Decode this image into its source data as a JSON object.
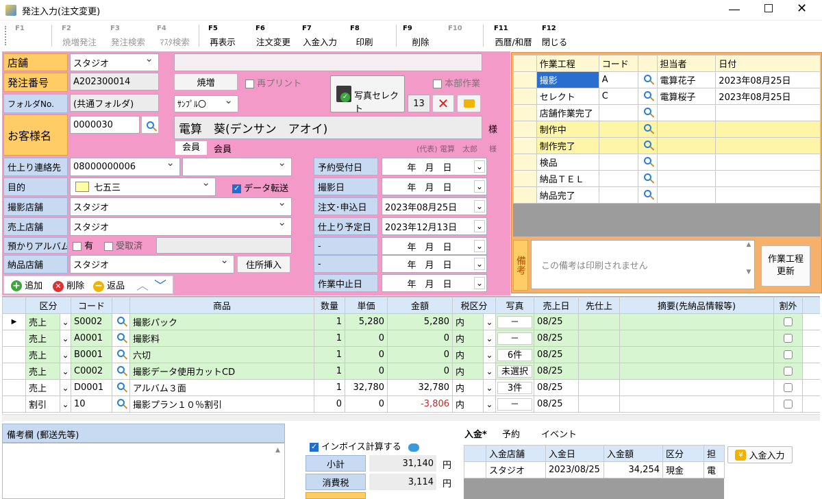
{
  "window": {
    "title": "発注入力(注文変更)"
  },
  "fkeys": [
    {
      "key": "F1",
      "label": "",
      "enabled": false
    },
    {
      "key": "F2",
      "label": "焼増発注",
      "enabled": false
    },
    {
      "key": "F3",
      "label": "発注検索",
      "enabled": false
    },
    {
      "key": "F4",
      "label": "ﾏｽﾀ検索",
      "enabled": false
    },
    {
      "key": "F5",
      "label": "再表示",
      "enabled": true
    },
    {
      "key": "F6",
      "label": "注文変更",
      "enabled": true
    },
    {
      "key": "F7",
      "label": "入金入力",
      "enabled": true
    },
    {
      "key": "F8",
      "label": "印刷",
      "enabled": true
    },
    {
      "key": "F9",
      "label": "削除",
      "enabled": true
    },
    {
      "key": "F10",
      "label": "",
      "enabled": false
    },
    {
      "key": "F11",
      "label": "西暦/和暦",
      "enabled": true
    },
    {
      "key": "F12",
      "label": "閉じる",
      "enabled": true
    }
  ],
  "header": {
    "store_label": "店舗",
    "store_value": "スタジオ",
    "order_no_label": "発注番号",
    "order_no_value": "A202300014",
    "folder_label": "フォルダNo.",
    "folder_value": "(共通フォルダ)",
    "customer_label": "お客様名",
    "customer_code": "0000030",
    "customer_name": "電算　葵(デンサン　アオイ)",
    "honorific": "様",
    "member_badge": "会員",
    "member_text": "会員",
    "rep_text": "(代表) 電算　太郎",
    "rep_honorific": "様",
    "yakimashi_btn": "焼増",
    "reprint_label": "再プリント",
    "sample_value": "ｻﾝﾌﾟﾙ〇",
    "photo_select_btn": "写真セレクト",
    "honbu_label": "本部作業",
    "photo_count": "13"
  },
  "form": {
    "contact_label": "仕上り連絡先",
    "contact_value": "08000000006",
    "contact_value2": "",
    "purpose_label": "目的",
    "purpose_value": "七五三",
    "purpose_color": "#ffffa8",
    "data_transfer_label": "データ転送",
    "shoot_store_label": "撮影店舗",
    "shoot_store_value": "スタジオ",
    "sales_store_label": "売上店舗",
    "sales_store_value": "スタジオ",
    "album_label": "預かりアルバム",
    "album_has": "有",
    "album_received": "受取済",
    "album_note": "",
    "delivery_store_label": "納品店舗",
    "delivery_store_value": "スタジオ",
    "address_btn": "住所挿入"
  },
  "dates": [
    {
      "label": "予約受付日",
      "value": "年　月　日"
    },
    {
      "label": "撮影日",
      "value": "年　月　日"
    },
    {
      "label": "注文･申込日",
      "value": "2023年08月25日"
    },
    {
      "label": "仕上り予定日",
      "value": "2023年12月13日"
    },
    {
      "label": "-",
      "value": "年　月　日"
    },
    {
      "label": "-",
      "value": "年　月　日"
    },
    {
      "label": "作業中止日",
      "value": "年　月　日"
    }
  ],
  "row_actions": {
    "add": "追加",
    "delete": "削除",
    "return": "返品"
  },
  "workflow": {
    "headers": [
      "作業工程",
      "コード",
      "担当者",
      "日付"
    ],
    "rows": [
      {
        "step": "撮影",
        "code": "A",
        "person": "電算花子",
        "date": "2023年08月25日"
      },
      {
        "step": "セレクト",
        "code": "C",
        "person": "電算桜子",
        "date": "2023年08月25日"
      },
      {
        "step": "店舗作業完了",
        "code": "",
        "person": "",
        "date": ""
      },
      {
        "step": "制作中",
        "code": "",
        "person": "",
        "date": ""
      },
      {
        "step": "制作完了",
        "code": "",
        "person": "",
        "date": ""
      },
      {
        "step": "検品",
        "code": "",
        "person": "",
        "date": ""
      },
      {
        "step": "納品ＴＥＬ",
        "code": "",
        "person": "",
        "date": ""
      },
      {
        "step": "納品完了",
        "code": "",
        "person": "",
        "date": ""
      }
    ],
    "memo_label": "備考",
    "memo_placeholder": "この備考は印刷されません",
    "update_btn": "作業工程\n更新"
  },
  "grid": {
    "headers": [
      "区分",
      "コード",
      "商品",
      "数量",
      "単価",
      "金額",
      "税区分",
      "写真",
      "売上日",
      "先仕上",
      "摘要(先納品情報等)",
      "割外"
    ],
    "rows": [
      {
        "kubun": "売上",
        "code": "S0002",
        "item": "撮影パック",
        "qty": "1",
        "price": "5,280",
        "amount": "5,280",
        "tax": "内",
        "photo": "－",
        "date": "08/25",
        "green": true,
        "neg": false
      },
      {
        "kubun": "売上",
        "code": "A0001",
        "item": "撮影料",
        "qty": "1",
        "price": "0",
        "amount": "0",
        "tax": "内",
        "photo": "－",
        "date": "08/25",
        "green": true,
        "neg": false
      },
      {
        "kubun": "売上",
        "code": "B0001",
        "item": "六切",
        "qty": "1",
        "price": "0",
        "amount": "0",
        "tax": "内",
        "photo": "6件",
        "date": "08/25",
        "green": true,
        "neg": false
      },
      {
        "kubun": "売上",
        "code": "C0002",
        "item": "撮影データ使用カットCD",
        "qty": "1",
        "price": "0",
        "amount": "0",
        "tax": "内",
        "photo": "未選択",
        "date": "08/25",
        "green": true,
        "neg": false
      },
      {
        "kubun": "売上",
        "code": "D0001",
        "item": "アルバム３面",
        "qty": "1",
        "price": "32,780",
        "amount": "32,780",
        "tax": "内",
        "photo": "3件",
        "date": "08/25",
        "green": false,
        "neg": false
      },
      {
        "kubun": "割引",
        "code": "10",
        "item": "撮影プラン１０％割引",
        "qty": "0",
        "price": "0",
        "amount": "-3,806",
        "tax": "内",
        "photo": "－",
        "date": "08/25",
        "green": false,
        "neg": true
      }
    ]
  },
  "bottom": {
    "memo_title": "備考欄 (郵送先等)",
    "invoice_label": "インボイス計算する",
    "subtotal_label": "小計",
    "subtotal_value": "31,140",
    "tax_label": "消費税",
    "tax_value": "3,114",
    "yen": "円",
    "tabs": [
      "入金*",
      "予約",
      "イベント"
    ],
    "payment_headers": [
      "入金店舗",
      "入金日",
      "入金額",
      "区分",
      "担"
    ],
    "payment_row": [
      "スタジオ",
      "2023/08/25",
      "34,254",
      "現金",
      "電"
    ],
    "payment_btn": "入金入力"
  }
}
